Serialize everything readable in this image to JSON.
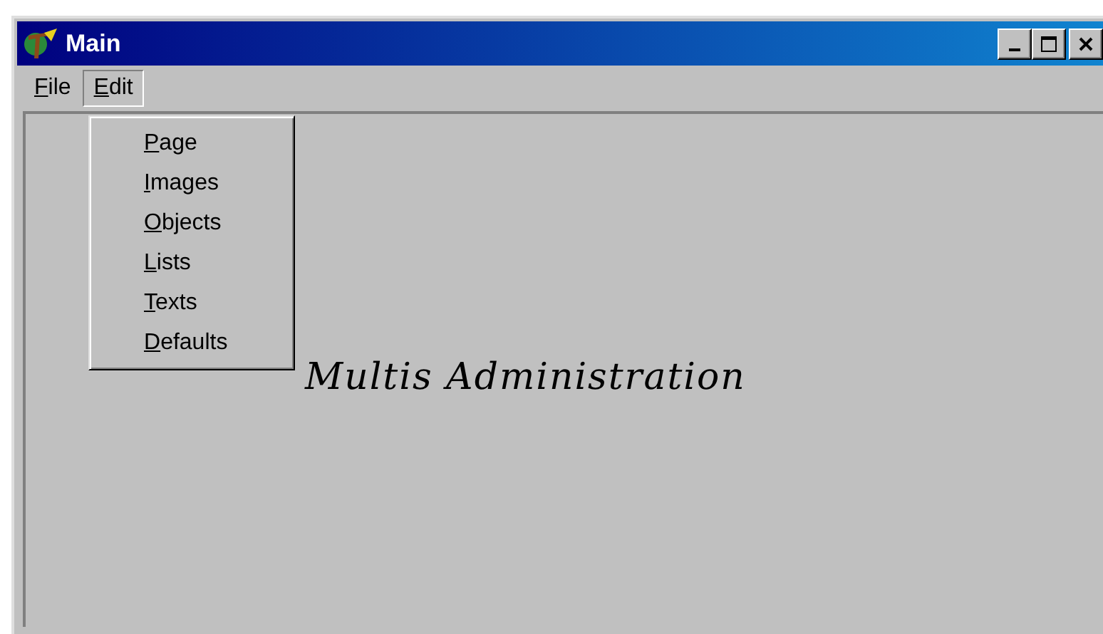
{
  "window": {
    "title": "Main"
  },
  "menu_bar": [
    {
      "label": "File",
      "selected": false
    },
    {
      "label": "Edit",
      "selected": true
    }
  ],
  "open_menu": {
    "items": [
      {
        "label": "Page"
      },
      {
        "label": "Images"
      },
      {
        "label": "Objects"
      },
      {
        "label": "Lists"
      },
      {
        "label": "Texts"
      },
      {
        "label": "Defaults"
      }
    ]
  },
  "heading": "Multis Administration"
}
